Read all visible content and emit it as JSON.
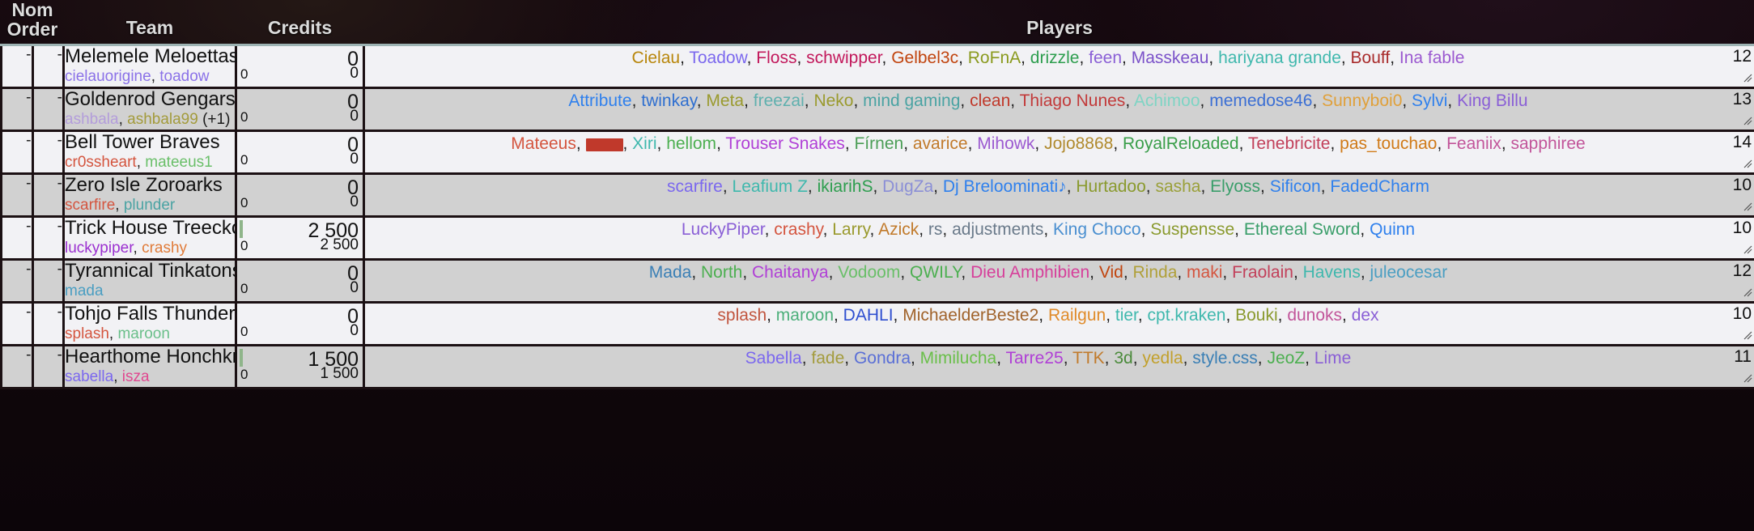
{
  "header": {
    "nom_order": "Nom\nOrder",
    "nom_order_line1": "Nom",
    "nom_order_line2": "Order",
    "team": "Team",
    "credits": "Credits",
    "players": "Players"
  },
  "icons": {
    "resize_grip": "resize-grip-icon"
  },
  "colors": {
    "header_text": "#dcdcdc",
    "row_odd_bg": "#f2f2f5",
    "row_even_bg": "#d1d1d1",
    "grid_line": "#1b1013",
    "header_rule": "#9db3b3",
    "credit_bar": "#8fb58a",
    "redaction": "#c0392b"
  },
  "rows": [
    {
      "nom": "-",
      "order": "-",
      "team": "Melemele Meloettas",
      "members": [
        {
          "name": "cielauorigine",
          "color": "#8b72e8"
        },
        {
          "name": "toadow",
          "color": "#8b72e8"
        }
      ],
      "extra": "",
      "credits_big": "0",
      "credits_left": "0",
      "credits_right": "0",
      "has_bar": false,
      "player_count": "12",
      "players": [
        {
          "name": "Cielau",
          "color": "#b8860b"
        },
        {
          "name": "Toadow",
          "color": "#7b68ee"
        },
        {
          "name": "Floss",
          "color": "#c2185b"
        },
        {
          "name": "schwipper",
          "color": "#c2185b"
        },
        {
          "name": "Gelbel3c",
          "color": "#c1440e"
        },
        {
          "name": "RoFnA",
          "color": "#8a9a1e"
        },
        {
          "name": "drizzle",
          "color": "#2e9e4f"
        },
        {
          "name": "feen",
          "color": "#8a5fd6"
        },
        {
          "name": "Masskeau",
          "color": "#7b52c9"
        },
        {
          "name": "hariyana grande",
          "color": "#3fb8ad"
        },
        {
          "name": "Bouff",
          "color": "#a82a2a"
        },
        {
          "name": "Ina fable",
          "color": "#9b59d0"
        }
      ]
    },
    {
      "nom": "-",
      "order": "-",
      "team": "Goldenrod Gengars",
      "members": [
        {
          "name": "ashbala",
          "color": "#b39ddb"
        },
        {
          "name": "ashbala99",
          "color": "#a39b3c"
        }
      ],
      "extra": "(+1)",
      "credits_big": "0",
      "credits_left": "0",
      "credits_right": "0",
      "has_bar": false,
      "player_count": "13",
      "players": [
        {
          "name": "Attribute",
          "color": "#2f80ed"
        },
        {
          "name": "twinkay",
          "color": "#2f6fd0"
        },
        {
          "name": "Meta",
          "color": "#9a9a2e"
        },
        {
          "name": "freezai",
          "color": "#5fb0ae"
        },
        {
          "name": "Neko",
          "color": "#9a9a2e"
        },
        {
          "name": "mind gaming",
          "color": "#4aa3a3"
        },
        {
          "name": "clean",
          "color": "#c0392b"
        },
        {
          "name": "Thiago Nunes",
          "color": "#c23a3a"
        },
        {
          "name": "Achimoo",
          "color": "#7fd4c4"
        },
        {
          "name": "memedose46",
          "color": "#3b6fd4"
        },
        {
          "name": "Sunnyboi0",
          "color": "#e0a03a"
        },
        {
          "name": "Sylvi",
          "color": "#2f80ed"
        },
        {
          "name": "King Billu",
          "color": "#8a5fd6"
        }
      ]
    },
    {
      "nom": "-",
      "order": "-",
      "team": "Bell Tower Braves",
      "members": [
        {
          "name": "cr0ssheart",
          "color": "#d4553f"
        },
        {
          "name": "mateeus1",
          "color": "#6abf69"
        }
      ],
      "extra": "",
      "credits_big": "0",
      "credits_left": "0",
      "credits_right": "0",
      "has_bar": false,
      "player_count": "14",
      "players": [
        {
          "name": "Mateeus",
          "color": "#d4553f"
        },
        {
          "name": "███",
          "color": "#c0392b",
          "redacted": true
        },
        {
          "name": "Xiri",
          "color": "#3fb8ad"
        },
        {
          "name": "hellom",
          "color": "#4caf50"
        },
        {
          "name": "Trouser Snakes",
          "color": "#b03fd6"
        },
        {
          "name": "Fírnen",
          "color": "#4c9e57"
        },
        {
          "name": "avarice",
          "color": "#c17a2b"
        },
        {
          "name": "Mihowk",
          "color": "#9b59d0"
        },
        {
          "name": "Jojo8868",
          "color": "#b08a2e"
        },
        {
          "name": "RoyalReloaded",
          "color": "#3a9e4a"
        },
        {
          "name": "Tenebricite",
          "color": "#c2405a"
        },
        {
          "name": "pas_touchao",
          "color": "#d07a18"
        },
        {
          "name": "Feaniix",
          "color": "#c2559a"
        },
        {
          "name": "sapphiree",
          "color": "#c2559a"
        }
      ]
    },
    {
      "nom": "-",
      "order": "-",
      "team": "Zero Isle Zoroarks",
      "members": [
        {
          "name": "scarfire",
          "color": "#d4553f"
        },
        {
          "name": "plunder",
          "color": "#4aa3a3"
        }
      ],
      "extra": "",
      "credits_big": "0",
      "credits_left": "0",
      "credits_right": "0",
      "has_bar": false,
      "player_count": "10",
      "players": [
        {
          "name": "scarfire",
          "color": "#7b68ee"
        },
        {
          "name": "Leafium Z",
          "color": "#3fb8ad"
        },
        {
          "name": "ikiarihS",
          "color": "#2e9e4f"
        },
        {
          "name": "DugZa",
          "color": "#8b8fd6"
        },
        {
          "name": "Dj Breloominati♪",
          "color": "#2f80ed"
        },
        {
          "name": "Hurtadoo",
          "color": "#8a9a2e"
        },
        {
          "name": "sasha",
          "color": "#9aa03a"
        },
        {
          "name": "Elyoss",
          "color": "#3a9e6a"
        },
        {
          "name": "Sificon",
          "color": "#2f80ed"
        },
        {
          "name": "FadedCharm",
          "color": "#2f80ed"
        }
      ]
    },
    {
      "nom": "-",
      "order": "-",
      "team": "Trick House Treeckos",
      "members": [
        {
          "name": "luckypiper",
          "color": "#9b30d0"
        },
        {
          "name": "crashy",
          "color": "#e07b39"
        }
      ],
      "extra": "",
      "credits_big": "2 500",
      "credits_left": "0",
      "credits_right": "2 500",
      "has_bar": true,
      "player_count": "10",
      "players": [
        {
          "name": "LuckyPiper",
          "color": "#8a5fd6"
        },
        {
          "name": "crashy",
          "color": "#d4553f"
        },
        {
          "name": "Larry",
          "color": "#9a9a2e"
        },
        {
          "name": "Azick",
          "color": "#c17a2b"
        },
        {
          "name": "rs",
          "color": "#6a7a8a"
        },
        {
          "name": "adjustments",
          "color": "#6a7a8a"
        },
        {
          "name": "King Choco",
          "color": "#4a8fd0"
        },
        {
          "name": "Suspensse",
          "color": "#8a9a2e"
        },
        {
          "name": "Ethereal Sword",
          "color": "#3a9e6a"
        },
        {
          "name": "Quinn",
          "color": "#2f80ed"
        }
      ]
    },
    {
      "nom": "-",
      "order": "-",
      "team": "Tyrannical Tinkatons",
      "members": [
        {
          "name": "mada",
          "color": "#4a9ec2"
        }
      ],
      "extra": "",
      "credits_big": "0",
      "credits_left": "0",
      "credits_right": "0",
      "has_bar": false,
      "player_count": "12",
      "players": [
        {
          "name": "Mada",
          "color": "#3a7fb5"
        },
        {
          "name": "North",
          "color": "#4caf50"
        },
        {
          "name": "Chaitanya",
          "color": "#b03fd6"
        },
        {
          "name": "Vodoom",
          "color": "#6abf69"
        },
        {
          "name": "QWILY",
          "color": "#4caf50"
        },
        {
          "name": "Dieu Amphibien",
          "color": "#d63f9a"
        },
        {
          "name": "Vid",
          "color": "#c1440e"
        },
        {
          "name": "Rinda",
          "color": "#b0a03a"
        },
        {
          "name": "maki",
          "color": "#d4553f"
        },
        {
          "name": "Fraolain",
          "color": "#c2405a"
        },
        {
          "name": "Havens",
          "color": "#3fb8ad"
        },
        {
          "name": "juleocesar",
          "color": "#4a9ec2"
        }
      ]
    },
    {
      "nom": "-",
      "order": "-",
      "team": "Tohjo Falls Thunders",
      "members": [
        {
          "name": "splash",
          "color": "#d4553f"
        },
        {
          "name": "maroon",
          "color": "#6abf8a"
        }
      ],
      "extra": "",
      "credits_big": "0",
      "credits_left": "0",
      "credits_right": "0",
      "has_bar": false,
      "player_count": "10",
      "players": [
        {
          "name": "splash",
          "color": "#c1553f"
        },
        {
          "name": "maroon",
          "color": "#4caf7a"
        },
        {
          "name": "DAHLI",
          "color": "#2f4fd0"
        },
        {
          "name": "MichaelderBeste2",
          "color": "#a0622a"
        },
        {
          "name": "Railgun",
          "color": "#e08b2a"
        },
        {
          "name": "tier",
          "color": "#3fb8ad"
        },
        {
          "name": "cpt.kraken",
          "color": "#3fb8ad"
        },
        {
          "name": "Bouki",
          "color": "#8a9a2e"
        },
        {
          "name": "dunoks",
          "color": "#c2559a"
        },
        {
          "name": "dex",
          "color": "#8a5fd6"
        }
      ]
    },
    {
      "nom": "-",
      "order": "-",
      "team": "Hearthome Honchkrows",
      "members": [
        {
          "name": "sabella",
          "color": "#7b68ee"
        },
        {
          "name": "isza",
          "color": "#e0478f"
        }
      ],
      "extra": "",
      "credits_big": "1 500",
      "credits_left": "0",
      "credits_right": "1 500",
      "has_bar": true,
      "player_count": "11",
      "players": [
        {
          "name": "Sabella",
          "color": "#7b68ee"
        },
        {
          "name": "fade",
          "color": "#a39b3c"
        },
        {
          "name": "Gondra",
          "color": "#5a6fd6"
        },
        {
          "name": "Mimilucha",
          "color": "#6abf4a"
        },
        {
          "name": "Tarre25",
          "color": "#b03fd6"
        },
        {
          "name": "TTK",
          "color": "#c17a2b"
        },
        {
          "name": "3d",
          "color": "#4a8a3a"
        },
        {
          "name": "yedla",
          "color": "#c2a02b"
        },
        {
          "name": "style.css",
          "color": "#3a7fb5"
        },
        {
          "name": "JeoZ",
          "color": "#4caf50"
        },
        {
          "name": "Lime",
          "color": "#8a5fd6"
        }
      ]
    }
  ]
}
